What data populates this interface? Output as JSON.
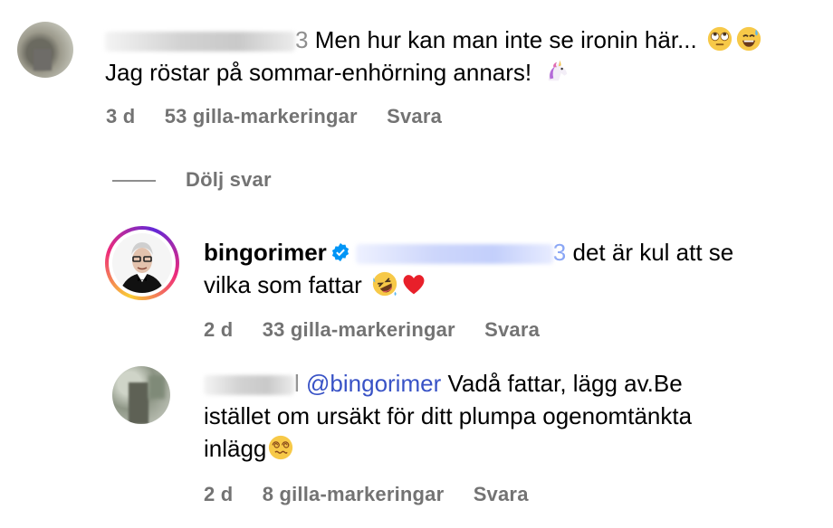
{
  "comments": [
    {
      "author_tail": "3",
      "text": "Men hur kan man inte se ironin här...",
      "text_line2": "Jag röstar på sommar-enhörning annars!",
      "time": "3 d",
      "likes": "53 gilla-markeringar",
      "reply": "Svara",
      "emojis": [
        "face-with-rolling-eyes",
        "grinning-face-with-sweat",
        "unicorn"
      ]
    }
  ],
  "toggle_replies": "Dölj svar",
  "replies": [
    {
      "author": "bingorimer",
      "verified": true,
      "mention_tail": "3",
      "text": "det är kul att se",
      "text_line2": "vilka som fattar",
      "time": "2 d",
      "likes": "33 gilla-markeringar",
      "reply": "Svara",
      "emojis": [
        "rolling-on-floor-laughing",
        "red-heart"
      ]
    },
    {
      "author_tail": "l",
      "mention": "@bingorimer",
      "text": "Vadå fattar, lägg av.Be",
      "text_line2": "istället om ursäkt för ditt plumpa ogenomtänkta",
      "text_line3": "inlägg",
      "time": "2 d",
      "likes": "8 gilla-markeringar",
      "reply": "Svara",
      "emojis": [
        "face-with-spiral-eyes"
      ]
    }
  ],
  "colors": {
    "meta_gray": "#737373",
    "mention_blue": "#3852c6",
    "verified_blue": "#0095f6"
  }
}
